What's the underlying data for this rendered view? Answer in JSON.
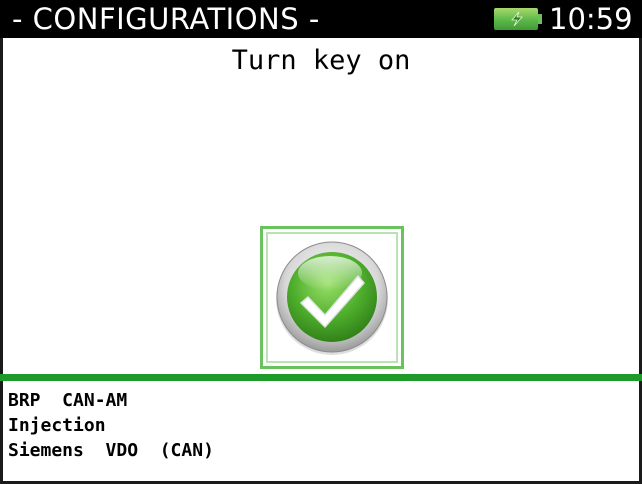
{
  "header": {
    "title": "- CONFIGURATIONS -",
    "time": "10:59",
    "battery_icon": "battery-charging-icon",
    "battery_color": "#5db84a"
  },
  "main": {
    "instruction": "Turn key on",
    "confirm_icon": "checkmark-icon",
    "accent_color": "#1e9a2a"
  },
  "vehicle_info": {
    "brand": "BRP  CAN-AM",
    "system": "Injection",
    "ecu": "Siemens  VDO  (CAN)"
  }
}
